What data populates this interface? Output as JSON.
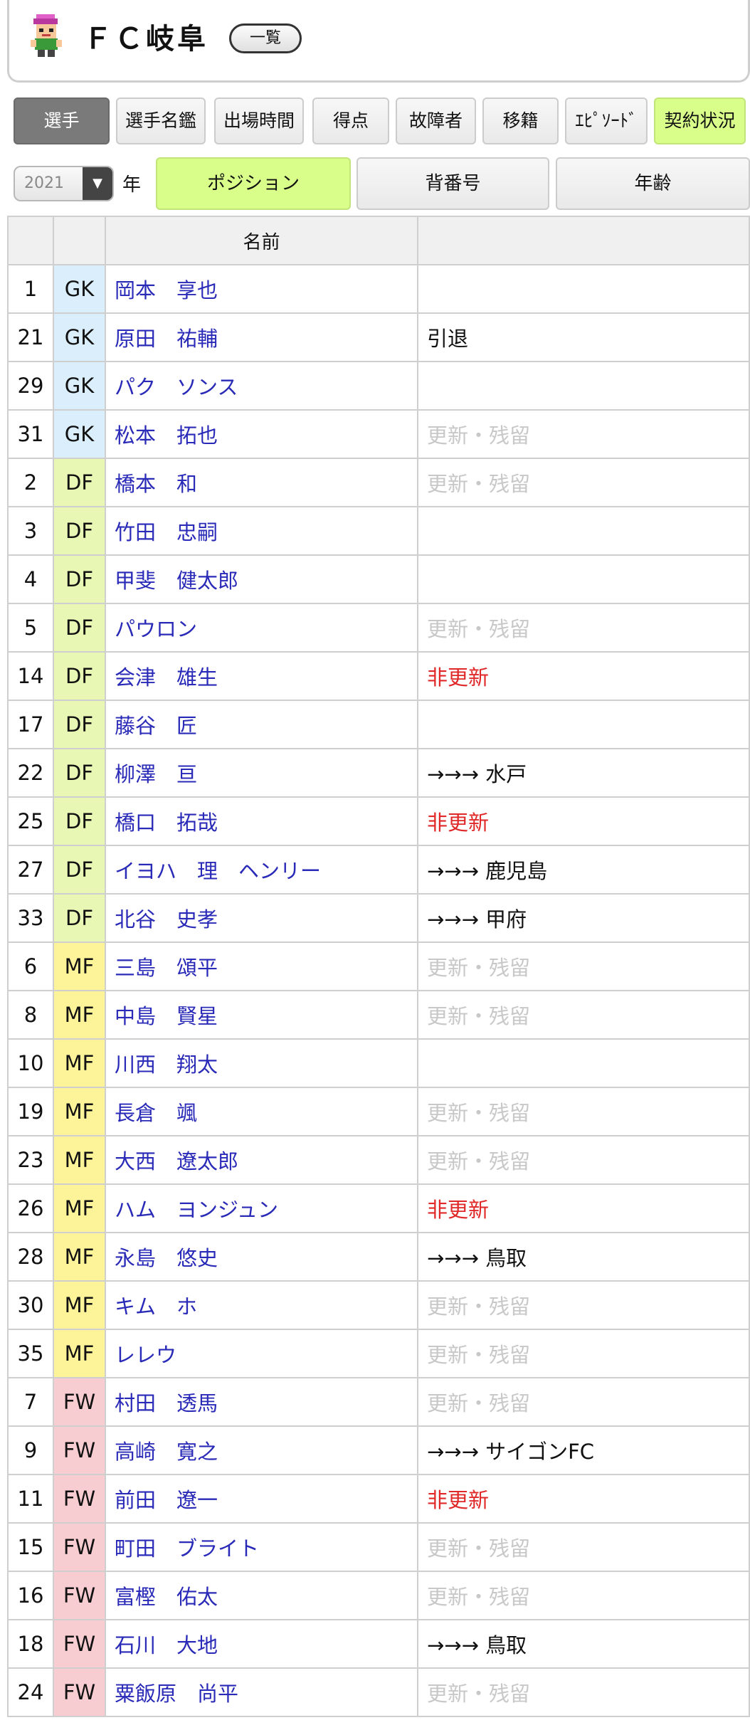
{
  "header": {
    "team_name": "ＦＣ岐阜",
    "list_button": "一覧"
  },
  "nav": {
    "tabs": [
      {
        "label": "選手",
        "state": "active"
      },
      {
        "label": "選手名鑑",
        "state": "normal"
      },
      {
        "label": "出場時間",
        "state": "normal"
      },
      {
        "label": "得点",
        "state": "normal"
      },
      {
        "label": "故障者",
        "state": "normal"
      },
      {
        "label": "移籍",
        "state": "normal"
      },
      {
        "label": "ｴﾋﾟｿｰﾄﾞ",
        "state": "normal"
      },
      {
        "label": "契約状況",
        "state": "highlight"
      }
    ]
  },
  "sort": {
    "year_value": "2021",
    "year_label": "年",
    "tabs": [
      {
        "label": "ポジション",
        "state": "highlight"
      },
      {
        "label": "背番号",
        "state": "normal"
      },
      {
        "label": "年齢",
        "state": "normal"
      }
    ]
  },
  "table": {
    "header_name": "名前",
    "rows": [
      {
        "num": "1",
        "pos": "GK",
        "name": "岡本　享也",
        "status": "",
        "status_type": "none"
      },
      {
        "num": "21",
        "pos": "GK",
        "name": "原田　祐輔",
        "status": "引退",
        "status_type": "retire"
      },
      {
        "num": "29",
        "pos": "GK",
        "name": "パク　ソンス",
        "status": "",
        "status_type": "none"
      },
      {
        "num": "31",
        "pos": "GK",
        "name": "松本　拓也",
        "status": "更新・残留",
        "status_type": "renew"
      },
      {
        "num": "2",
        "pos": "DF",
        "name": "橋本　和",
        "status": "更新・残留",
        "status_type": "renew"
      },
      {
        "num": "3",
        "pos": "DF",
        "name": "竹田　忠嗣",
        "status": "",
        "status_type": "none"
      },
      {
        "num": "4",
        "pos": "DF",
        "name": "甲斐　健太郎",
        "status": "",
        "status_type": "none"
      },
      {
        "num": "5",
        "pos": "DF",
        "name": "パウロン",
        "status": "更新・残留",
        "status_type": "renew"
      },
      {
        "num": "14",
        "pos": "DF",
        "name": "会津　雄生",
        "status": "非更新",
        "status_type": "nonrenew"
      },
      {
        "num": "17",
        "pos": "DF",
        "name": "藤谷　匠",
        "status": "",
        "status_type": "none"
      },
      {
        "num": "22",
        "pos": "DF",
        "name": "柳澤　亘",
        "status": "→→→ 水戸",
        "status_type": "transfer"
      },
      {
        "num": "25",
        "pos": "DF",
        "name": "橋口　拓哉",
        "status": "非更新",
        "status_type": "nonrenew"
      },
      {
        "num": "27",
        "pos": "DF",
        "name": "イヨハ　理　ヘンリー",
        "status": "→→→ 鹿児島",
        "status_type": "transfer"
      },
      {
        "num": "33",
        "pos": "DF",
        "name": "北谷　史孝",
        "status": "→→→ 甲府",
        "status_type": "transfer"
      },
      {
        "num": "6",
        "pos": "MF",
        "name": "三島　頌平",
        "status": "更新・残留",
        "status_type": "renew"
      },
      {
        "num": "8",
        "pos": "MF",
        "name": "中島　賢星",
        "status": "更新・残留",
        "status_type": "renew"
      },
      {
        "num": "10",
        "pos": "MF",
        "name": "川西　翔太",
        "status": "",
        "status_type": "none"
      },
      {
        "num": "19",
        "pos": "MF",
        "name": "長倉　颯",
        "status": "更新・残留",
        "status_type": "renew"
      },
      {
        "num": "23",
        "pos": "MF",
        "name": "大西　遼太郎",
        "status": "更新・残留",
        "status_type": "renew"
      },
      {
        "num": "26",
        "pos": "MF",
        "name": "ハム　ヨンジュン",
        "status": "非更新",
        "status_type": "nonrenew"
      },
      {
        "num": "28",
        "pos": "MF",
        "name": "永島　悠史",
        "status": "→→→ 鳥取",
        "status_type": "transfer"
      },
      {
        "num": "30",
        "pos": "MF",
        "name": "キム　ホ",
        "status": "更新・残留",
        "status_type": "renew"
      },
      {
        "num": "35",
        "pos": "MF",
        "name": "レレウ",
        "status": "更新・残留",
        "status_type": "renew"
      },
      {
        "num": "7",
        "pos": "FW",
        "name": "村田　透馬",
        "status": "更新・残留",
        "status_type": "renew"
      },
      {
        "num": "9",
        "pos": "FW",
        "name": "高崎　寛之",
        "status": "→→→ サイゴンFC",
        "status_type": "transfer"
      },
      {
        "num": "11",
        "pos": "FW",
        "name": "前田　遼一",
        "status": "非更新",
        "status_type": "nonrenew"
      },
      {
        "num": "15",
        "pos": "FW",
        "name": "町田　ブライト",
        "status": "更新・残留",
        "status_type": "renew"
      },
      {
        "num": "16",
        "pos": "FW",
        "name": "富樫　佑太",
        "status": "更新・残留",
        "status_type": "renew"
      },
      {
        "num": "18",
        "pos": "FW",
        "name": "石川　大地",
        "status": "→→→ 鳥取",
        "status_type": "transfer"
      },
      {
        "num": "24",
        "pos": "FW",
        "name": "粟飯原　尚平",
        "status": "更新・残留",
        "status_type": "renew"
      }
    ]
  }
}
